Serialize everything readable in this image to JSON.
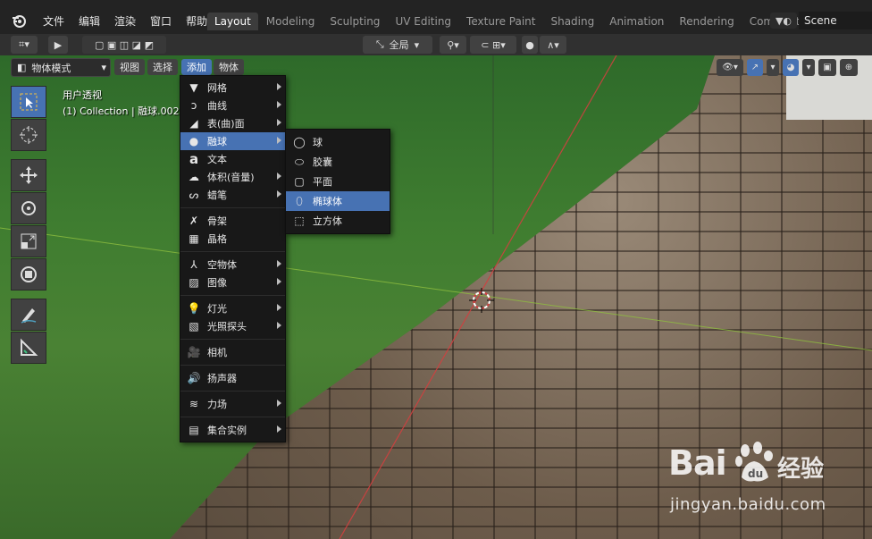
{
  "menubar": {
    "items": [
      "文件",
      "编辑",
      "渲染",
      "窗口",
      "帮助"
    ]
  },
  "workspaces": [
    "Layout",
    "Modeling",
    "Sculpting",
    "UV Editing",
    "Texture Paint",
    "Shading",
    "Animation",
    "Rendering",
    "Compositing"
  ],
  "active_workspace": "Layout",
  "scene": {
    "name": "Scene"
  },
  "tool_header": {
    "transform_orientation": "全局"
  },
  "viewport_header": {
    "mode": "物体模式",
    "buttons": [
      "视图",
      "选择",
      "添加",
      "物体"
    ],
    "active_button": "添加"
  },
  "viewport_info": {
    "view_name": "用户透视",
    "collection": "(1) Collection | 融球.002"
  },
  "add_menu": {
    "items": [
      {
        "label": "网格",
        "icon": "mesh-icon",
        "submenu": true
      },
      {
        "label": "曲线",
        "icon": "curve-icon",
        "submenu": true
      },
      {
        "label": "表(曲)面",
        "icon": "surface-icon",
        "submenu": true
      },
      {
        "label": "融球",
        "icon": "metaball-icon",
        "submenu": true,
        "highlighted": true
      },
      {
        "label": "文本",
        "icon": "text-icon",
        "submenu": false
      },
      {
        "label": "体积(音量)",
        "icon": "volume-icon",
        "submenu": true
      },
      {
        "label": "蜡笔",
        "icon": "grease-pencil-icon",
        "submenu": true
      },
      {
        "label": "骨架",
        "icon": "armature-icon",
        "submenu": false
      },
      {
        "label": "晶格",
        "icon": "lattice-icon",
        "submenu": false
      },
      {
        "label": "空物体",
        "icon": "empty-icon",
        "submenu": true
      },
      {
        "label": "图像",
        "icon": "image-icon",
        "submenu": true
      },
      {
        "label": "灯光",
        "icon": "light-icon",
        "submenu": true
      },
      {
        "label": "光照探头",
        "icon": "light-probe-icon",
        "submenu": true
      },
      {
        "label": "相机",
        "icon": "camera-icon",
        "submenu": false
      },
      {
        "label": "扬声器",
        "icon": "speaker-icon",
        "submenu": false
      },
      {
        "label": "力场",
        "icon": "force-field-icon",
        "submenu": true
      },
      {
        "label": "集合实例",
        "icon": "collection-instance-icon",
        "submenu": true
      }
    ]
  },
  "metaball_submenu": {
    "items": [
      {
        "label": "球",
        "icon": "ball-icon"
      },
      {
        "label": "胶囊",
        "icon": "capsule-icon"
      },
      {
        "label": "平面",
        "icon": "plane-icon"
      },
      {
        "label": "椭球体",
        "icon": "ellipsoid-icon",
        "highlighted": true
      },
      {
        "label": "立方体",
        "icon": "cube-icon"
      }
    ]
  },
  "watermark": {
    "brand": "Bai",
    "brand2": "du",
    "service": "经验",
    "url": "jingyan.baidu.com"
  },
  "colors": {
    "accent": "#4772b3",
    "menu_bg": "#181818"
  }
}
